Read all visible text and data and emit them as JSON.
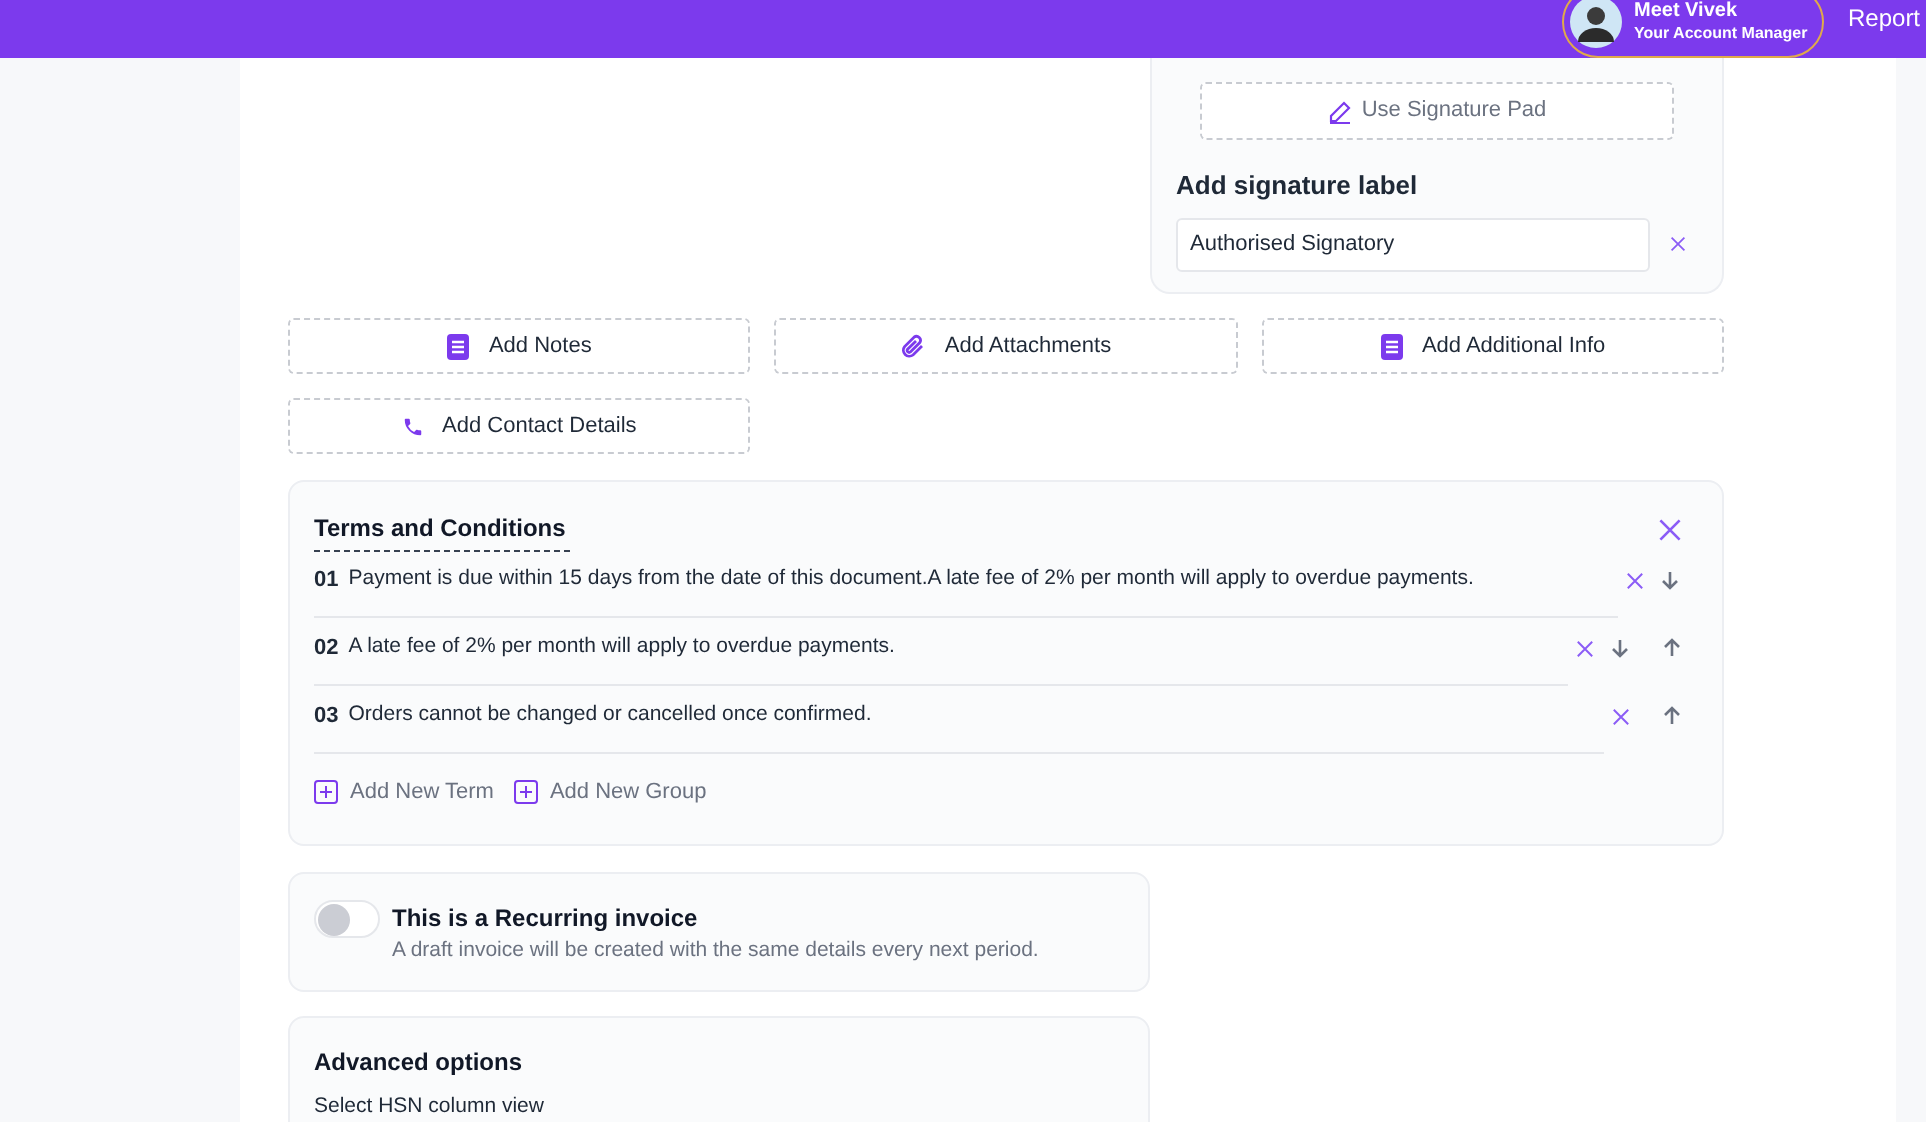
{
  "header": {
    "manager_name": "Meet Vivek",
    "manager_role": "Your Account Manager",
    "report_link": "Report"
  },
  "signature": {
    "pad_button": "Use Signature Pad",
    "label_heading": "Add signature label",
    "label_value": "Authorised Signatory"
  },
  "add_buttons": [
    {
      "kind": "notes",
      "label": "Add Notes"
    },
    {
      "kind": "attachment",
      "label": "Add Attachments"
    },
    {
      "kind": "notes",
      "label": "Add Additional Info"
    },
    {
      "kind": "phone",
      "label": "Add Contact Details"
    }
  ],
  "terms": {
    "title": "Terms and Conditions",
    "items": [
      {
        "number": "01",
        "text": "Payment is due within 15 days from the date of this document.A late fee of 2% per month will apply to overdue payments.",
        "can_move_down": true,
        "can_move_up": false
      },
      {
        "number": "02",
        "text": "A late fee of 2% per month will apply to overdue payments.",
        "can_move_down": true,
        "can_move_up": true
      },
      {
        "number": "03",
        "text": "Orders cannot be changed or cancelled once confirmed.",
        "can_move_down": false,
        "can_move_up": true
      }
    ],
    "add_term": "Add New Term",
    "add_group": "Add New Group"
  },
  "recurring": {
    "on": false,
    "title": "This is a Recurring invoice",
    "description": "A draft invoice will be created with the same details every next period."
  },
  "advanced": {
    "title": "Advanced options",
    "hsn_label": "Select HSN column view"
  }
}
